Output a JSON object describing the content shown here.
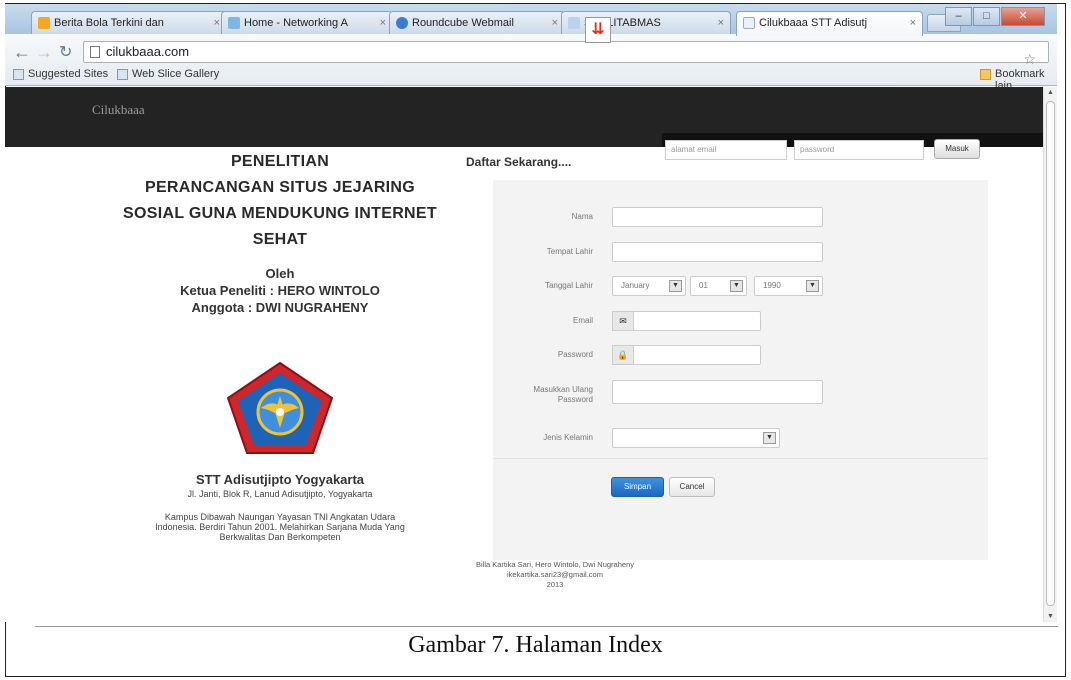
{
  "browser": {
    "tabs": [
      {
        "label": "Berita Bola Terkini dan",
        "color": "#f6a623"
      },
      {
        "label": "Home - Networking A",
        "color": "#7fb6e6"
      },
      {
        "label": "Roundcube Webmail",
        "color": "#3a7bd5"
      },
      {
        "label": "SIM-LITABMAS",
        "color": "#b9d3ee"
      },
      {
        "label": "Cilukbaaa STT Adisutj",
        "color": "#e9f1fa"
      }
    ],
    "url": "cilukbaaa.com",
    "bookmarks": {
      "suggested": "Suggested Sites",
      "webslice": "Web Slice Gallery",
      "other": "Bookmark lain"
    }
  },
  "site": {
    "brand": "Cilukbaaa",
    "login": {
      "email_placeholder": "alamat email",
      "password_placeholder": "password",
      "submit": "Masuk"
    }
  },
  "left": {
    "title_lines": [
      "PENELITIAN",
      "PERANCANGAN SITUS JEJARING",
      "SOSIAL GUNA MENDUKUNG INTERNET",
      "SEHAT"
    ],
    "oleh": "Oleh",
    "ketua": "Ketua Peneliti : HERO WINTOLO",
    "anggota": "Anggota : DWI NUGRAHENY",
    "campus": "STT Adisutjipto Yogyakarta",
    "address": "Jl. Janti, Blok R, Lanud Adisutjipto, Yogyakarta",
    "desc_lines": [
      "Kampus Dibawah Naungan Yayasan TNI Angkatan Udara",
      "Indonesia. Berdiri Tahun 2001. Melahirkan Sarjana Muda Yang",
      "Berkwalitas Dan Berkompeten"
    ]
  },
  "form": {
    "heading": "Daftar Sekarang....",
    "nama": "Nama",
    "tempat_lahir": "Tempat Lahir",
    "tanggal_lahir": "Tanggal Lahir",
    "month": "January",
    "day": "01",
    "year": "1990",
    "email": "Email",
    "email_icon": "✉",
    "password": "Password",
    "password_icon": "🔒",
    "ulang_password_lines": [
      "Masukkan Ulang",
      "Password"
    ],
    "jenis_kelamin": "Jenis Kelamin",
    "save": "Simpan",
    "cancel": "Cancel"
  },
  "footer": {
    "lines": [
      "Billa Kartika Sari, Hero Wintolo, Dwi Nugraheny",
      "ikekartika.sari23@gmail.com",
      "2013"
    ]
  },
  "caption": "Gambar 7. Halaman Index"
}
